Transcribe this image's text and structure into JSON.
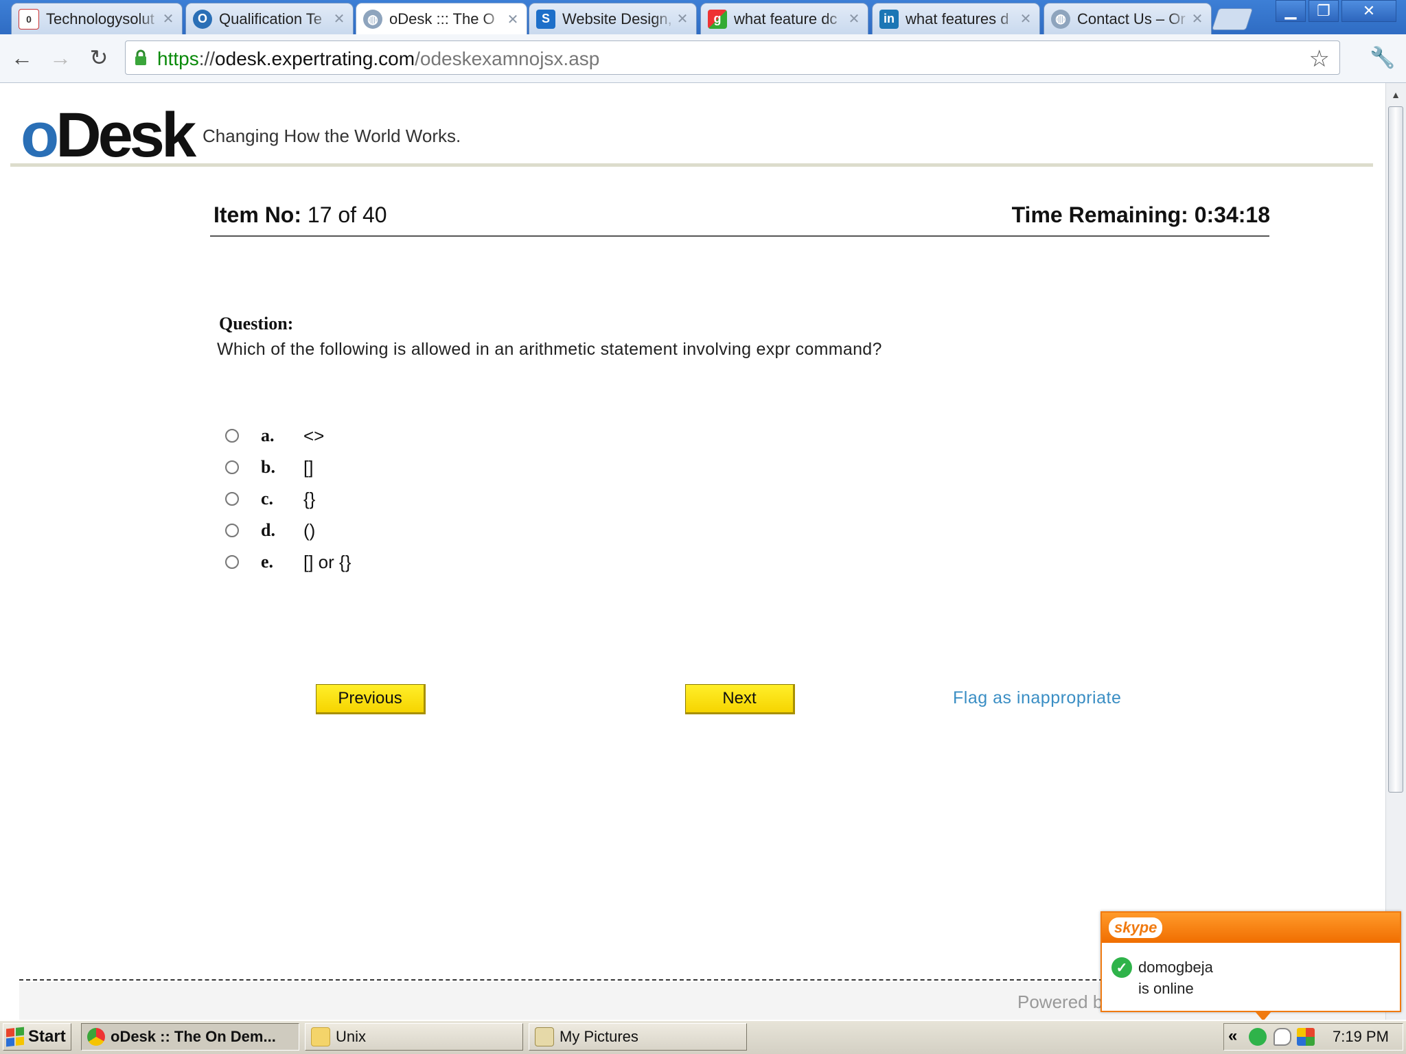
{
  "browser": {
    "tabs": [
      {
        "label": "Technologysolut",
        "icon": "gmail-icon"
      },
      {
        "label": "Qualification Te",
        "icon": "odesk-icon"
      },
      {
        "label": "oDesk ::: The O",
        "icon": "globe-icon"
      },
      {
        "label": "Website Design,",
        "icon": "s-logo-icon"
      },
      {
        "label": "what feature dc",
        "icon": "google-icon"
      },
      {
        "label": "what features d",
        "icon": "linkedin-icon"
      },
      {
        "label": "Contact Us – Or",
        "icon": "globe-icon"
      }
    ],
    "gmail_badge": "0",
    "url_scheme": "https",
    "url_sep": "://",
    "url_host": "odesk.expertrating.com",
    "url_path": "/odeskexamnojsx.asp"
  },
  "header": {
    "logo_o": "o",
    "logo_rest": "Desk",
    "tagline": "Changing How the World Works."
  },
  "exam": {
    "item_label": "Item No:",
    "item_value": "17 of 40",
    "time_label": "Time Remaining:",
    "time_value": "0:34:18",
    "question_label": "Question:",
    "question_text": "Which of the following is allowed in an arithmetic statement involving expr command?",
    "options": [
      {
        "letter": "a.",
        "text": "<>"
      },
      {
        "letter": "b.",
        "text": "[]"
      },
      {
        "letter": "c.",
        "text": "{}"
      },
      {
        "letter": "d.",
        "text": "()"
      },
      {
        "letter": "e.",
        "text": "[] or {}"
      }
    ],
    "previous_label": "Previous",
    "next_label": "Next",
    "flag_label": "Flag as inappropriate"
  },
  "footer": {
    "powered": "Powered b"
  },
  "skype": {
    "brand": "skype",
    "user": "domogbeja",
    "status": "is online"
  },
  "taskbar": {
    "start": "Start",
    "buttons": [
      {
        "label": "oDesk :: The On Dem..."
      },
      {
        "label": "Unix"
      },
      {
        "label": "My Pictures"
      }
    ],
    "chevron": "«",
    "clock": "7:19 PM"
  },
  "colors": {
    "odesk_blue": "#2a6fb6",
    "button_yellow": "#f6d400",
    "link_blue": "#3a8ec4",
    "skype_orange": "#f07a10"
  }
}
